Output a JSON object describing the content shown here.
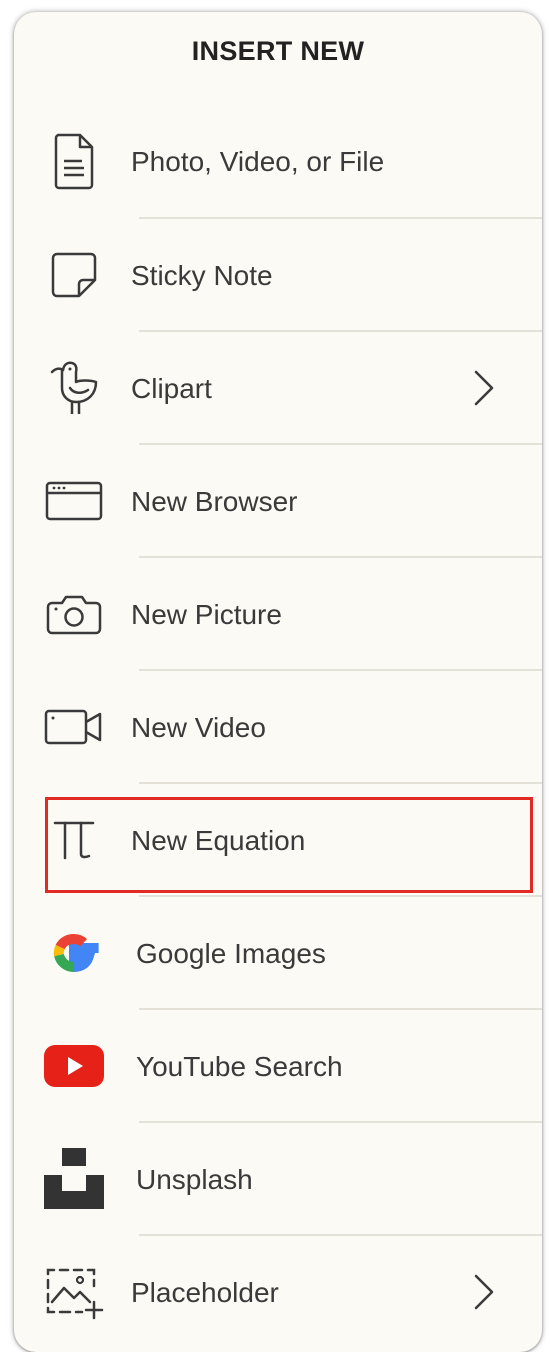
{
  "menu": {
    "title": "INSERT NEW",
    "items": [
      {
        "label": "Photo, Video, or File",
        "icon": "document-icon"
      },
      {
        "label": "Sticky Note",
        "icon": "sticky-note-icon"
      },
      {
        "label": "Clipart",
        "icon": "bird-icon",
        "has_submenu": true
      },
      {
        "label": "New Browser",
        "icon": "browser-window-icon"
      },
      {
        "label": "New Picture",
        "icon": "camera-icon"
      },
      {
        "label": "New Video",
        "icon": "video-camera-icon"
      },
      {
        "label": "New Equation",
        "icon": "pi-icon",
        "highlighted": true
      },
      {
        "label": "Google Images",
        "icon": "google-logo-icon"
      },
      {
        "label": "YouTube Search",
        "icon": "youtube-logo-icon"
      },
      {
        "label": "Unsplash",
        "icon": "unsplash-logo-icon"
      },
      {
        "label": "Placeholder",
        "icon": "placeholder-image-icon",
        "has_submenu": true
      }
    ]
  },
  "colors": {
    "panel_background": "#fbfaf4",
    "icon_stroke": "#3a3a3a",
    "highlight_border": "#e02a23",
    "youtube_red": "#e62117",
    "unsplash_dark": "#333333"
  }
}
